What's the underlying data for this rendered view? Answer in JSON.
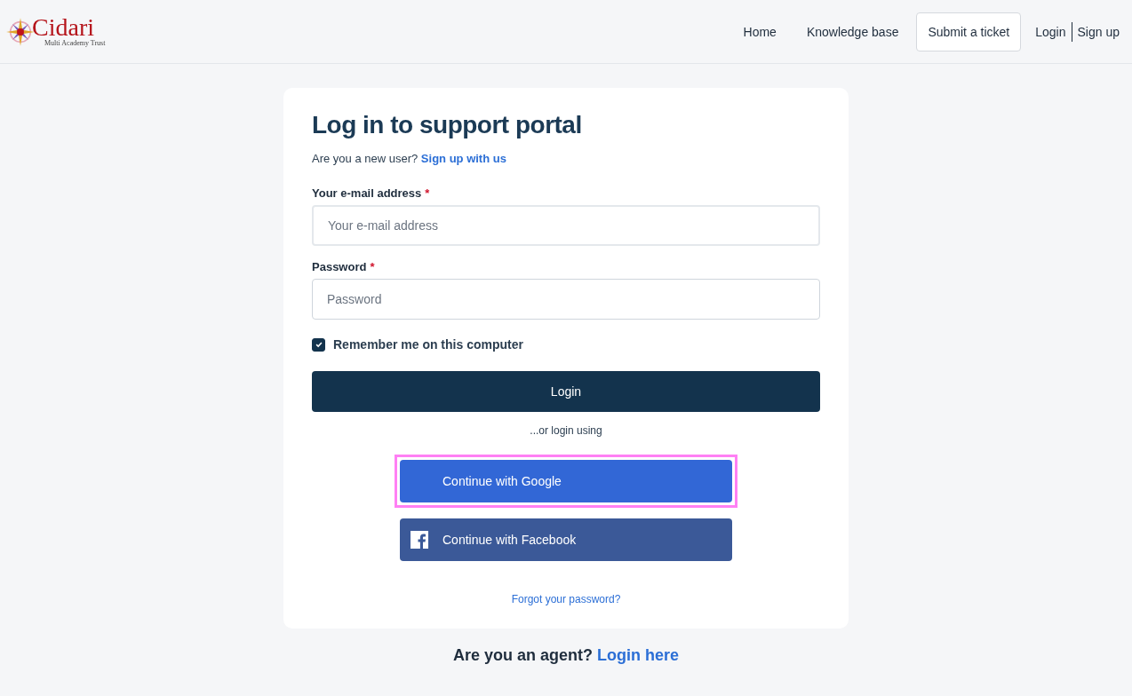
{
  "logo": {
    "name": "Cidari",
    "tagline": "Multi Academy Trust"
  },
  "nav": [
    {
      "label": "Home",
      "selected": false
    },
    {
      "label": "Knowledge base",
      "selected": false
    },
    {
      "label": "Submit a ticket",
      "selected": true
    }
  ],
  "auth_links": [
    "Login",
    "Sign up"
  ],
  "card": {
    "title": "Log in to support portal",
    "subtitle": "Are you a new user?",
    "signup_link": "Sign up with us",
    "fields": [
      {
        "label": "Your e-mail address",
        "required_mark": "*",
        "placeholder": "Your e-mail address",
        "focused": true
      },
      {
        "label": "Password",
        "required_mark": "*",
        "placeholder": "Password",
        "focused": false
      }
    ],
    "remember": {
      "label": "Remember me on this computer",
      "checked": true
    },
    "login_button": "Login",
    "divider_text": "...or login using",
    "social_buttons": [
      {
        "label": "Continue with Google",
        "kind": "google",
        "highlighted": true
      },
      {
        "label": "Continue with Facebook",
        "kind": "facebook",
        "highlighted": false
      }
    ],
    "forgot_link": "Forgot your password?"
  },
  "agent": {
    "text": "Are you an agent?",
    "link": "Login here"
  }
}
